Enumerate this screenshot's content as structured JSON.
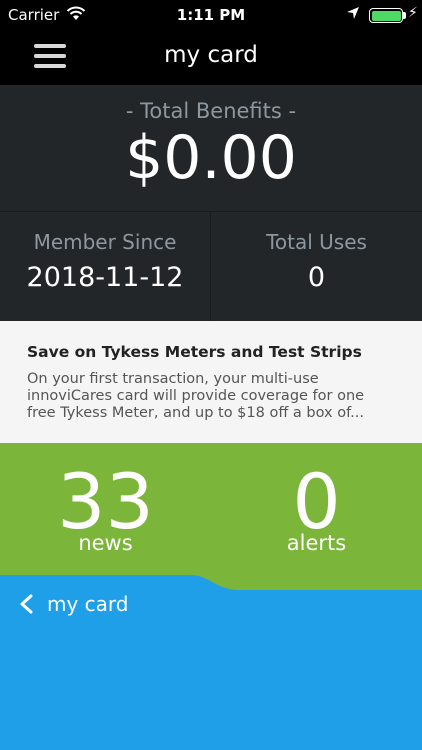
{
  "status_bar": {
    "carrier": "Carrier",
    "time": "1:11 PM",
    "battery_color": "#4cd964"
  },
  "nav": {
    "title": "my card",
    "menu_icon": "hamburger-icon"
  },
  "benefits": {
    "label": "-  Total Benefits  -",
    "amount": "$0.00"
  },
  "stats": {
    "member_since_label": "Member Since",
    "member_since_value": "2018-11-12",
    "total_uses_label": "Total Uses",
    "total_uses_value": "0"
  },
  "promo": {
    "title": "Save on Tykess Meters and Test Strips",
    "body": "On your first transaction, your multi-use innoviCares card will provide coverage for one free Tykess Meter, and up to $18 off a box of..."
  },
  "counters": {
    "news_count": "33",
    "news_label": "news",
    "alerts_count": "0",
    "alerts_label": "alerts",
    "color": "#7bb63a"
  },
  "bottom": {
    "back_label": "my card",
    "back_icon": "chevron-left-icon",
    "color": "#1e9fe8"
  }
}
